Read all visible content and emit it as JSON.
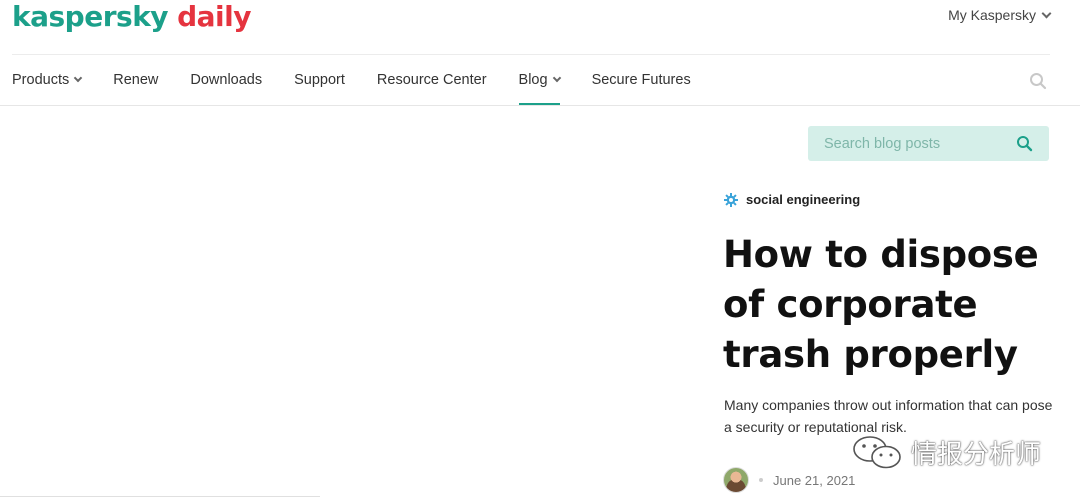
{
  "header": {
    "logo_brand": "kaspersky",
    "logo_sub": "daily",
    "account_label": "My Kaspersky"
  },
  "nav": {
    "items": [
      {
        "label": "Products",
        "dropdown": true
      },
      {
        "label": "Renew",
        "dropdown": false
      },
      {
        "label": "Downloads",
        "dropdown": false
      },
      {
        "label": "Support",
        "dropdown": false
      },
      {
        "label": "Resource Center",
        "dropdown": false
      },
      {
        "label": "Blog",
        "dropdown": true,
        "active": true
      },
      {
        "label": "Secure Futures",
        "dropdown": false
      }
    ],
    "search_icon": "search-icon"
  },
  "blog_search": {
    "placeholder": "Search blog posts",
    "icon": "search-icon"
  },
  "article": {
    "category": "social engineering",
    "category_icon": "gear-icon",
    "title_lines": [
      "How to dispose",
      "of corporate",
      "trash properly"
    ],
    "lede": "Many companies throw out information that can pose a security or reputational risk.",
    "date": "June 21, 2021"
  },
  "watermark": {
    "text": "情报分析师"
  },
  "colors": {
    "brand": "#1ca08a",
    "daily": "#e5343f",
    "search_bg": "#d5efe9"
  }
}
